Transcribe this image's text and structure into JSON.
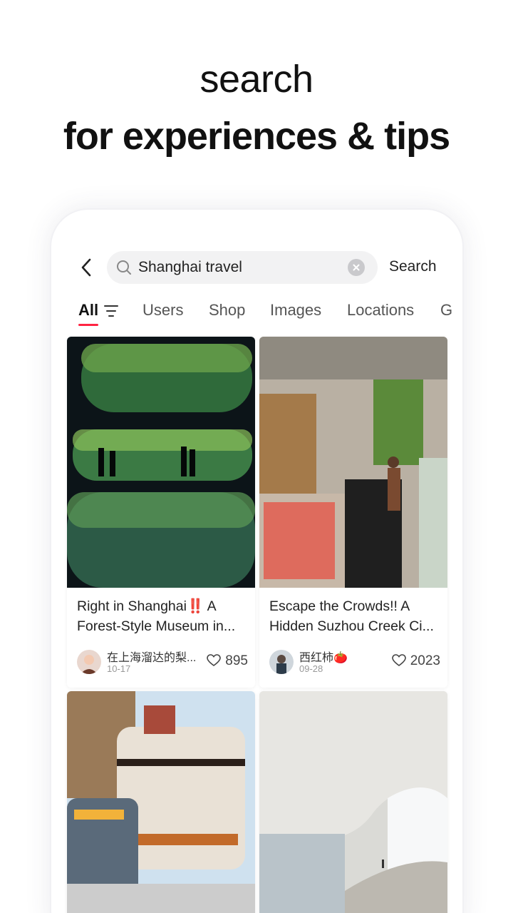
{
  "hero": {
    "line1": "search",
    "line2": "for experiences & tips"
  },
  "search": {
    "value": "Shanghai travel",
    "placeholder": "Shanghai travel",
    "button_label": "Search"
  },
  "tabs": [
    {
      "label": "All",
      "active": true
    },
    {
      "label": "Users"
    },
    {
      "label": "Shop"
    },
    {
      "label": "Images"
    },
    {
      "label": "Locations"
    },
    {
      "label": "G"
    }
  ],
  "cards": [
    {
      "title": "Right in Shanghai‼️ A Forest-Style Museum in...",
      "author": "在上海溜达的梨...",
      "date": "10-17",
      "likes": "895"
    },
    {
      "title": "Escape the Crowds!! A Hidden Suzhou Creek Ci...",
      "author": "西红柿🍅",
      "date": "09-28",
      "likes": "2023"
    },
    {
      "title": "",
      "author": "",
      "date": "",
      "likes": ""
    },
    {
      "title": "",
      "author": "",
      "date": "",
      "likes": ""
    }
  ],
  "colors": {
    "accent": "#ff2442",
    "background": "#ffffff",
    "search_bg": "#f2f2f3"
  },
  "icons": {
    "back": "chevron-left-icon",
    "search": "search-icon",
    "clear": "clear-icon",
    "filter": "filter-icon",
    "like": "heart-icon"
  }
}
